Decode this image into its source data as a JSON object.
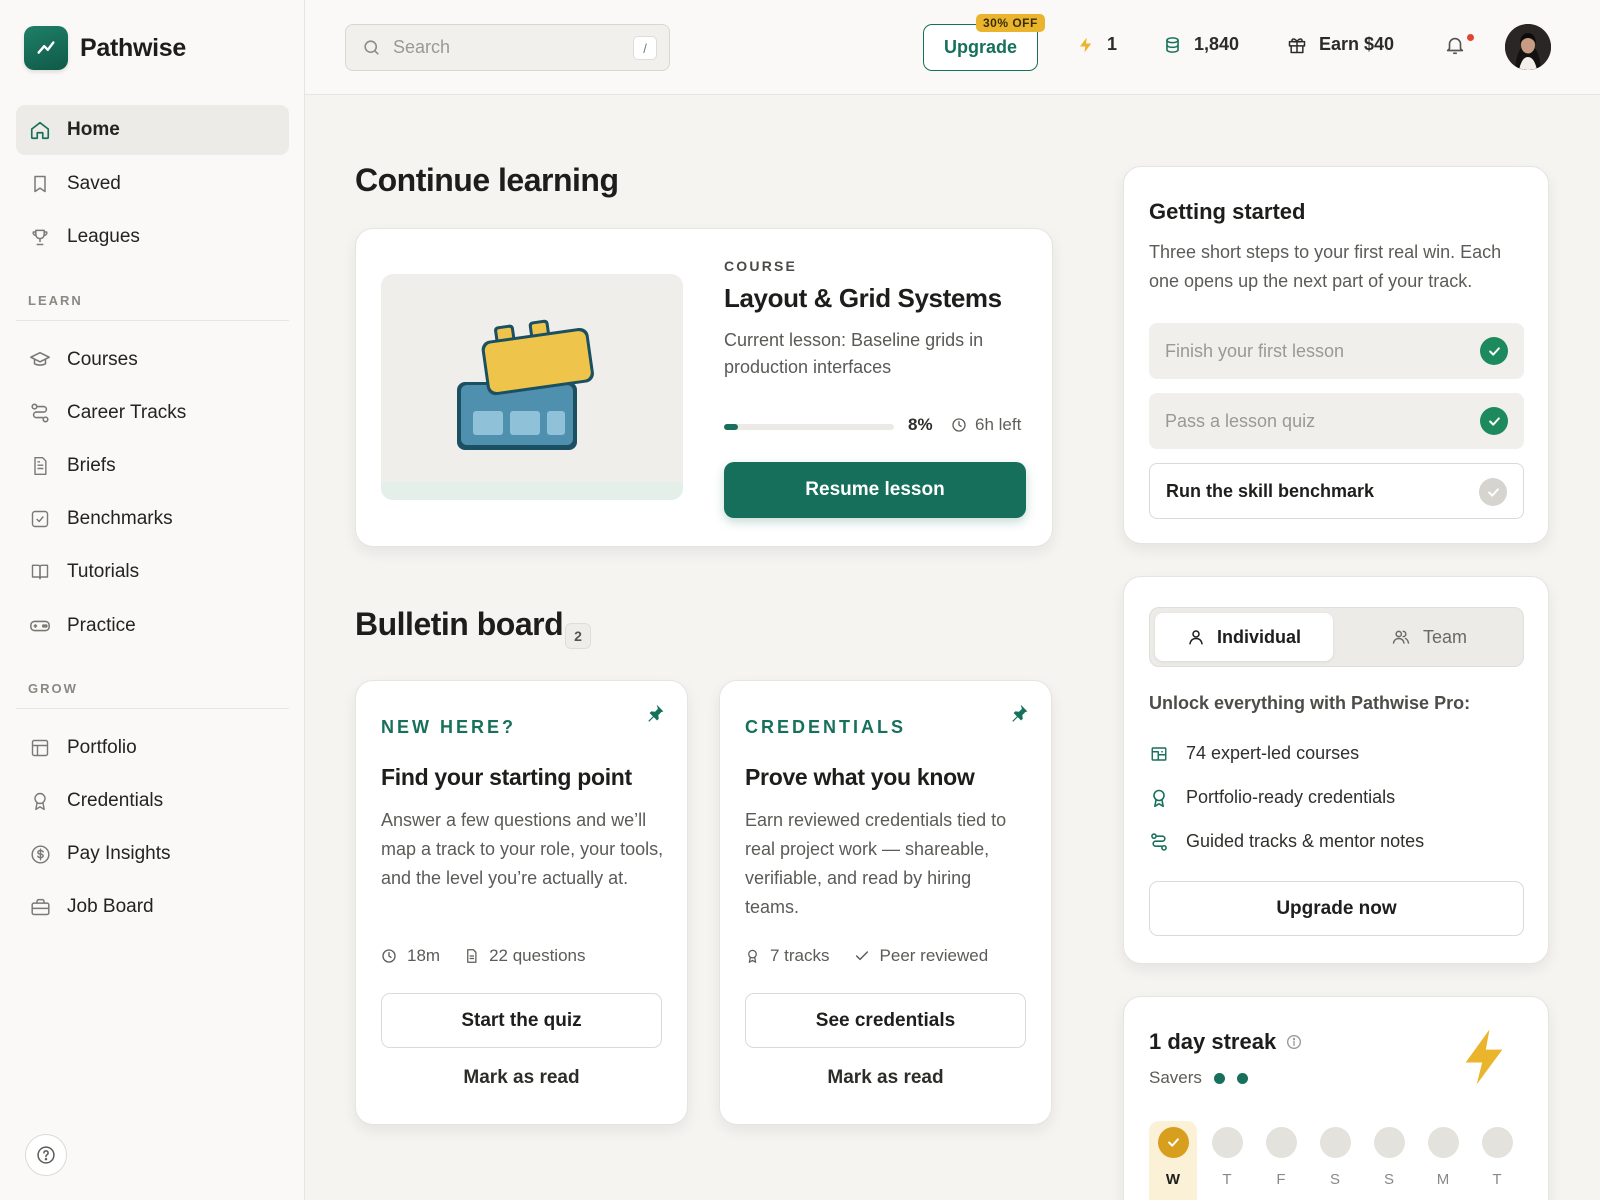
{
  "brand": {
    "name": "Pathwise",
    "accent": "#17705b"
  },
  "sidebar": {
    "primary": [
      {
        "label": "Home",
        "icon": "home-icon",
        "active": true
      },
      {
        "label": "Saved",
        "icon": "bookmark-icon"
      },
      {
        "label": "Leagues",
        "icon": "trophy-icon"
      }
    ],
    "learn_heading": "LEARN",
    "learn": [
      {
        "label": "Courses",
        "icon": "graduation-cap-icon"
      },
      {
        "label": "Career Tracks",
        "icon": "route-icon"
      },
      {
        "label": "Briefs",
        "icon": "document-icon"
      },
      {
        "label": "Benchmarks",
        "icon": "checkbox-icon"
      },
      {
        "label": "Tutorials",
        "icon": "book-icon"
      },
      {
        "label": "Practice",
        "icon": "gamepad-icon"
      }
    ],
    "grow_heading": "GROW",
    "grow": [
      {
        "label": "Portfolio",
        "icon": "layout-icon"
      },
      {
        "label": "Credentials",
        "icon": "award-icon"
      },
      {
        "label": "Pay Insights",
        "icon": "dollar-circle-icon"
      },
      {
        "label": "Job Board",
        "icon": "briefcase-icon"
      }
    ]
  },
  "topbar": {
    "search_placeholder": "Search",
    "search_shortcut": "/",
    "upgrade_label": "Upgrade",
    "discount_badge": "30% OFF",
    "energy": "1",
    "coins": "1,840",
    "earn": "Earn $40"
  },
  "continue": {
    "heading": "Continue learning",
    "eyebrow": "COURSE",
    "title": "Layout & Grid Systems",
    "subtitle": "Current lesson: Baseline grids in production interfaces",
    "progress": 0.08,
    "progress_label": "8%",
    "time_left": "6h left",
    "resume_label": "Resume lesson"
  },
  "bulletin": {
    "heading": "Bulletin board",
    "count": "2",
    "cards": [
      {
        "tag": "NEW HERE?",
        "title": "Find your starting point",
        "desc": "Answer a few questions and we’ll map a track to your role, your tools, and the level you’re actually at.",
        "meta1": "18m",
        "meta2": "22 questions",
        "primary": "Start the quiz",
        "secondary": "Mark as read"
      },
      {
        "tag": "CREDENTIALS",
        "title": "Prove what you know",
        "desc": "Earn reviewed credentials tied to real project work — shareable, verifiable, and read by hiring teams.",
        "meta1": "7 tracks",
        "meta2": "Peer reviewed",
        "primary": "See credentials",
        "secondary": "Mark as read"
      }
    ]
  },
  "getting_started": {
    "title": "Getting started",
    "desc": "Three short steps to your first real win. Each one opens up the next part of your track.",
    "steps": [
      {
        "label": "Finish your first lesson",
        "done": true
      },
      {
        "label": "Pass a lesson quiz",
        "done": true
      },
      {
        "label": "Run the skill benchmark",
        "done": false
      }
    ]
  },
  "pro": {
    "tabs": [
      "Individual",
      "Team"
    ],
    "active_tab": "Individual",
    "heading": "Unlock everything with Pathwise Pro:",
    "features": [
      {
        "label": "74 expert-led courses",
        "icon": "courses-icon"
      },
      {
        "label": "Portfolio-ready credentials",
        "icon": "award-icon"
      },
      {
        "label": "Guided tracks & mentor notes",
        "icon": "route-icon"
      }
    ],
    "cta": "Upgrade now"
  },
  "streak": {
    "title": "1 day streak",
    "savers_label": "Savers",
    "savers_count": 2,
    "days": [
      "W",
      "T",
      "F",
      "S",
      "S",
      "M",
      "T"
    ],
    "today_index": 0,
    "accent": "#eab52c"
  }
}
